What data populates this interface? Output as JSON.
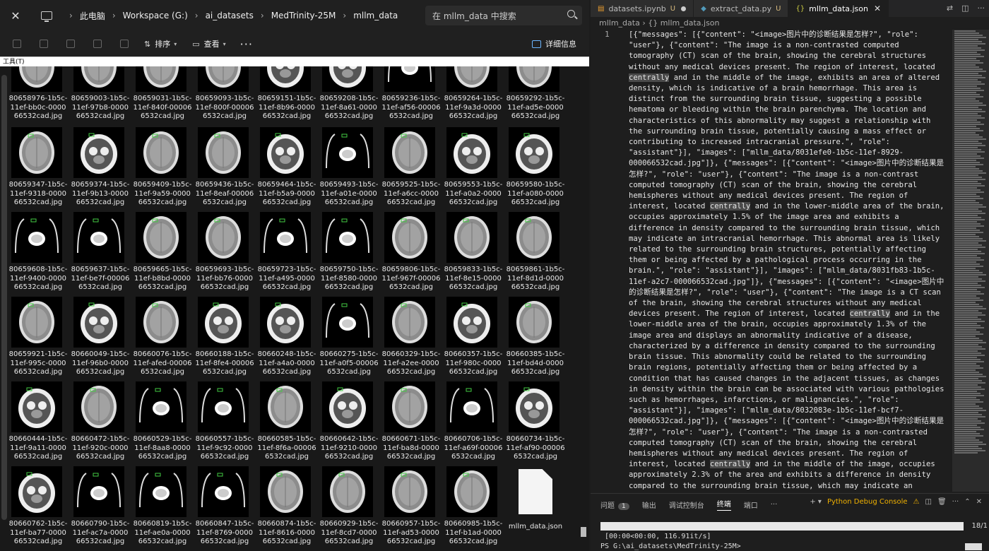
{
  "explorer": {
    "breadcrumb": [
      "此电脑",
      "Workspace (G:)",
      "ai_datasets",
      "MedTrinity-25M",
      "mllm_data"
    ],
    "search_placeholder": "在 mllm_data 中搜索",
    "sort_label": "排序",
    "view_label": "查看",
    "details_label": "详细信息",
    "tools_label": "工具(T)",
    "files": [
      {
        "name": "80658976-1b5c-11ef-bb0c-000066532cad.jpg",
        "scan": "brain"
      },
      {
        "name": "80659003-1b5c-11ef-97b8-000066532cad.jpg",
        "scan": "brain"
      },
      {
        "name": "80659031-1b5c-11ef-840f-000066532cad.jpg",
        "scan": "brain"
      },
      {
        "name": "80659093-1b5c-11ef-800f-000066532cad.jpg",
        "scan": "brain"
      },
      {
        "name": "80659151-1b5c-11ef-8b96-000066532cad.jpg",
        "scan": "skull"
      },
      {
        "name": "80659208-1b5c-11ef-8a61-000066532cad.jpg",
        "scan": "skull"
      },
      {
        "name": "80659236-1b5c-11ef-af56-000066532cad.jpg",
        "scan": "small"
      },
      {
        "name": "80659264-1b5c-11ef-9a3d-000066532cad.jpg",
        "scan": "brain"
      },
      {
        "name": "80659292-1b5c-11ef-ad5e-000066532cad.jpg",
        "scan": "brain"
      },
      {
        "name": "80659347-1b5c-11ef-9318-000066532cad.jpg",
        "scan": "brain"
      },
      {
        "name": "80659374-1b5c-11ef-9b13-000066532cad.jpg",
        "scan": "skull"
      },
      {
        "name": "80659409-1b5c-11ef-9a59-000066532cad.jpg",
        "scan": "brain"
      },
      {
        "name": "80659436-1b5c-11ef-8eaf-000066532cad.jpg",
        "scan": "brain"
      },
      {
        "name": "80659464-1b5c-11ef-b5a9-000066532cad.jpg",
        "scan": "skull"
      },
      {
        "name": "80659493-1b5c-11ef-a01e-000066532cad.jpg",
        "scan": "small"
      },
      {
        "name": "80659525-1b5c-11ef-a6cc-000066532cad.jpg",
        "scan": "brain"
      },
      {
        "name": "80659553-1b5c-11ef-a0a2-000066532cad.jpg",
        "scan": "skull"
      },
      {
        "name": "80659580-1b5c-11ef-a080-000066532cad.jpg",
        "scan": "skull"
      },
      {
        "name": "80659608-1b5c-11ef-9400-000066532cad.jpg",
        "scan": "small"
      },
      {
        "name": "80659637-1b5c-11ef-be7f-000066532cad.jpg",
        "scan": "small"
      },
      {
        "name": "80659665-1b5c-11ef-b8bd-000066532cad.jpg",
        "scan": "brain"
      },
      {
        "name": "80659693-1b5c-11ef-bb76-000066532cad.jpg",
        "scan": "brain"
      },
      {
        "name": "80659723-1b5c-11ef-a495-000066532cad.jpg",
        "scan": "small"
      },
      {
        "name": "80659750-1b5c-11ef-8580-000066532cad.jpg",
        "scan": "small"
      },
      {
        "name": "80659806-1b5c-11ef-967f-000066532cad.jpg",
        "scan": "brain"
      },
      {
        "name": "80659833-1b5c-11ef-8e15-000066532cad.jpg",
        "scan": "brain"
      },
      {
        "name": "80659861-1b5c-11ef-8d1d-000066532cad.jpg",
        "scan": "brain"
      },
      {
        "name": "80659921-1b5c-11ef-995c-000066532cad.jpg",
        "scan": "brain"
      },
      {
        "name": "80660049-1b5c-11ef-96b0-000066532cad.jpg",
        "scan": "skull"
      },
      {
        "name": "80660076-1b5c-11ef-afed-000066532cad.jpg",
        "scan": "brain"
      },
      {
        "name": "80660188-1b5c-11ef-8fe4-000066532cad.jpg",
        "scan": "skull"
      },
      {
        "name": "80660248-1b5c-11ef-a4a0-000066532cad.jpg",
        "scan": "skull"
      },
      {
        "name": "80660275-1b5c-11ef-a0f5-000066532cad.jpg",
        "scan": "small"
      },
      {
        "name": "80660329-1b5c-11ef-a2ee-000066532cad.jpg",
        "scan": "brain"
      },
      {
        "name": "80660357-1b5c-11ef-980c-000066532cad.jpg",
        "scan": "skull"
      },
      {
        "name": "80660385-1b5c-11ef-bd4d-000066532cad.jpg",
        "scan": "brain"
      },
      {
        "name": "80660444-1b5c-11ef-9a11-000066532cad.jpg",
        "scan": "skull"
      },
      {
        "name": "80660472-1b5c-11ef-920c-000066532cad.jpg",
        "scan": "brain"
      },
      {
        "name": "80660529-1b5c-11ef-8aa8-000066532cad.jpg",
        "scan": "small"
      },
      {
        "name": "80660557-1b5c-11ef-9c92-000066532cad.jpg",
        "scan": "small"
      },
      {
        "name": "80660585-1b5c-11ef-8f6a-000066532cad.jpg",
        "scan": "brain"
      },
      {
        "name": "80660642-1b5c-11ef-9210-000066532cad.jpg",
        "scan": "skull"
      },
      {
        "name": "80660671-1b5c-11ef-ba8d-000066532cad.jpg",
        "scan": "brain"
      },
      {
        "name": "80660706-1b5c-11ef-a69f-000066532cad.jpg",
        "scan": "small"
      },
      {
        "name": "80660734-1b5c-11ef-af90-000066532cad.jpg",
        "scan": "skull"
      },
      {
        "name": "80660762-1b5c-11ef-ba77-000066532cad.jpg",
        "scan": "skull"
      },
      {
        "name": "80660790-1b5c-11ef-ac7a-000066532cad.jpg",
        "scan": "small"
      },
      {
        "name": "80660819-1b5c-11ef-ae0a-000066532cad.jpg",
        "scan": "small"
      },
      {
        "name": "80660847-1b5c-11ef-8769-000066532cad.jpg",
        "scan": "small"
      },
      {
        "name": "80660874-1b5c-11ef-8616-000066532cad.jpg",
        "scan": "brain"
      },
      {
        "name": "80660929-1b5c-11ef-8cd7-000066532cad.jpg",
        "scan": "brain"
      },
      {
        "name": "80660957-1b5c-11ef-ad53-000066532cad.jpg",
        "scan": "brain"
      },
      {
        "name": "80660985-1b5c-11ef-b1ad-000066532cad.jpg",
        "scan": "brain"
      },
      {
        "name": "mllm_data.json",
        "scan": "json"
      }
    ]
  },
  "editor": {
    "tabs": [
      {
        "label": "datasets.ipynb",
        "status": "U",
        "icon": "notebook-icon"
      },
      {
        "label": "extract_data.py",
        "status": "U",
        "icon": "python-icon"
      },
      {
        "label": "mllm_data.json",
        "status": "",
        "icon": "json-icon"
      }
    ],
    "breadcrumb": "mllm_data  ›  {} mllm_data.json",
    "line_number": "1",
    "code": "[{\"messages\": [{\"content\": \"<image>图片中的诊断结果是怎样?\", \"role\": \"user\"}, {\"content\": \"The image is a non-contrasted computed tomography (CT) scan of the brain, showing the cerebral structures without any medical devices present. The region of interest, located centrally and in the middle of the image, exhibits an area of altered density, which is indicative of a brain hemorrhage. This area is distinct from the surrounding brain tissue, suggesting a possible hematoma or bleeding within the brain parenchyma. The location and characteristics of this abnormality may suggest a relationship with the surrounding brain tissue, potentially causing a mass effect or contributing to increased intracranial pressure.\", \"role\": \"assistant\"}], \"images\": [\"mllm_data/8031efe0-1b5c-11ef-8929-000066532cad.jpg\"]}, {\"messages\": [{\"content\": \"<image>图片中的诊断结果是怎样?\", \"role\": \"user\"}, {\"content\": \"The image is a non-contrast computed tomography (CT) scan of the brain, showing the cerebral hemispheres without any medical devices present. The region of interest, located centrally and in the lower-middle area of the brain, occupies approximately 1.5% of the image area and exhibits a difference in density compared to the surrounding brain tissue, which may indicate an intracranial hemorrhage. This abnormal area is likely related to the surrounding brain structures, potentially affecting them or being affected by a pathological process occurring in the brain.\", \"role\": \"assistant\"}], \"images\": [\"mllm_data/8031fb83-1b5c-11ef-a2c7-000066532cad.jpg\"]}, {\"messages\": [{\"content\": \"<image>图片中的诊断结果是怎样?\", \"role\": \"user\"}, {\"content\": \"The image is a CT scan of the brain, showing the cerebral structures without any medical devices present. The region of interest, located centrally and in the lower-middle area of the brain, occupies approximately 1.3% of the image area and displays an abnormality indicative of a disease, characterized by a difference in density compared to the surrounding brain tissue. This abnormality could be related to the surrounding brain regions, potentially affecting them or being affected by a condition that has caused changes in the adjacent tissues, as changes in density within the brain can be associated with various pathologies such as hemorrhages, infarctions, or malignancies.\", \"role\": \"assistant\"}], \"images\": [\"mllm_data/8032083e-1b5c-11ef-bcf7-000066532cad.jpg\"]}, {\"messages\": [{\"content\": \"<image>图片中的诊断结果是怎样?\", \"role\": \"user\"}, {\"content\": \"The image is a non-contrasted computed tomography (CT) scan of the brain, showing the cerebral hemispheres without any medical devices present. The region of interest, located centrally and in the middle of the image, occupies approximately 2.3% of the area and exhibits a difference in density compared to the surrounding brain tissue, which may indicate an intracranial hemorrhage. This abnormal area could be related to the surrounding brain structures, potentially",
    "highlight_word": "centrally"
  },
  "panel": {
    "tabs": [
      "问题",
      "输出",
      "调试控制台",
      "终端",
      "端口"
    ],
    "active_tab": "终端",
    "problems_count": "1",
    "debug_console_label": "Python Debug Console",
    "progress_percent": 100,
    "progress_count": "18/1",
    "progress_line": "[00:00<00:00, 116.91it/s]",
    "prompt_line": "PS G:\\ai_datasets\\MedTrinity-25M>"
  }
}
